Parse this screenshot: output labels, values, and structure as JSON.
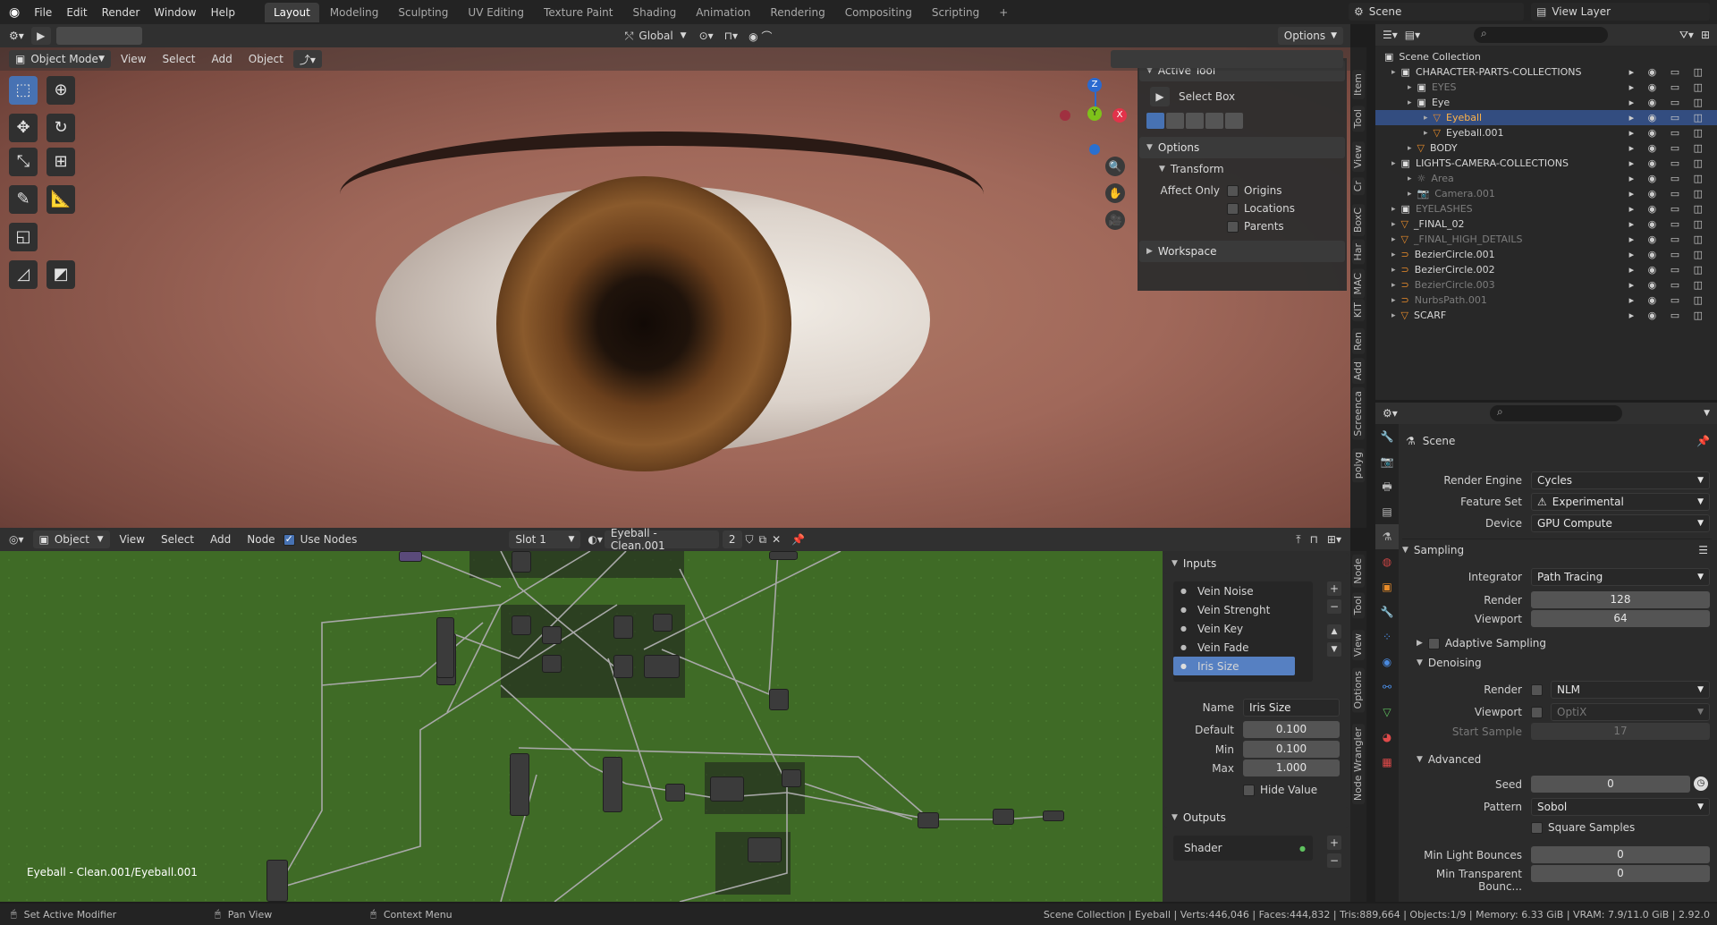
{
  "topbar": {
    "menus": [
      "File",
      "Edit",
      "Render",
      "Window",
      "Help"
    ],
    "workspaces": [
      "Layout",
      "Modeling",
      "Sculpting",
      "UV Editing",
      "Texture Paint",
      "Shading",
      "Animation",
      "Rendering",
      "Compositing",
      "Scripting"
    ],
    "active_workspace": "Layout",
    "add_tab": "+",
    "scene_name": "Scene",
    "view_layer": "View Layer"
  },
  "viewport": {
    "mode": "Object Mode",
    "menus": [
      "View",
      "Select",
      "Add",
      "Object"
    ],
    "transform_orientation": "Global",
    "options_label": "Options",
    "gizmo_axes": {
      "z": "Z",
      "y": "Y",
      "x": "X"
    }
  },
  "sidebar_n": {
    "active_tool_title": "Active Tool",
    "tool_name": "Select Box",
    "options_title": "Options",
    "transform_title": "Transform",
    "affect_only": "Affect Only",
    "checks": [
      "Origins",
      "Locations",
      "Parents"
    ],
    "workspace_title": "Workspace",
    "tabs": [
      "Item",
      "Tool",
      "View",
      "Cr",
      "BoxC",
      "Har",
      "MAC",
      "KIT",
      "Ren",
      "Add",
      "Screenca",
      "polyg"
    ]
  },
  "outliner": {
    "root": "Scene Collection",
    "rows": [
      {
        "label": "CHARACTER-PARTS-COLLECTIONS",
        "indent": 1,
        "kind": "coll",
        "dim": false,
        "sel": false
      },
      {
        "label": "EYES",
        "indent": 2,
        "kind": "coll",
        "dim": true,
        "sel": false
      },
      {
        "label": "Eye",
        "indent": 2,
        "kind": "coll",
        "dim": false,
        "sel": false
      },
      {
        "label": "Eyeball",
        "indent": 3,
        "kind": "obj",
        "dim": false,
        "sel": true
      },
      {
        "label": "Eyeball.001",
        "indent": 3,
        "kind": "obj",
        "dim": false,
        "sel": false
      },
      {
        "label": "BODY",
        "indent": 2,
        "kind": "obj",
        "dim": false,
        "sel": false
      },
      {
        "label": "LIGHTS-CAMERA-COLLECTIONS",
        "indent": 1,
        "kind": "coll",
        "dim": false,
        "sel": false
      },
      {
        "label": "Area",
        "indent": 2,
        "kind": "light",
        "dim": true,
        "sel": false
      },
      {
        "label": "Camera.001",
        "indent": 2,
        "kind": "cam",
        "dim": true,
        "sel": false
      },
      {
        "label": "EYELASHES",
        "indent": 1,
        "kind": "coll",
        "dim": true,
        "sel": false
      },
      {
        "label": "_FINAL_02",
        "indent": 1,
        "kind": "obj",
        "dim": false,
        "sel": false
      },
      {
        "label": "_FINAL_HIGH_DETAILS",
        "indent": 1,
        "kind": "obj",
        "dim": true,
        "sel": false
      },
      {
        "label": "BezierCircle.001",
        "indent": 1,
        "kind": "curve",
        "dim": false,
        "sel": false
      },
      {
        "label": "BezierCircle.002",
        "indent": 1,
        "kind": "curve",
        "dim": false,
        "sel": false
      },
      {
        "label": "BezierCircle.003",
        "indent": 1,
        "kind": "curve",
        "dim": true,
        "sel": false
      },
      {
        "label": "NurbsPath.001",
        "indent": 1,
        "kind": "curve",
        "dim": true,
        "sel": false
      },
      {
        "label": "SCARF",
        "indent": 1,
        "kind": "obj",
        "dim": false,
        "sel": false
      }
    ]
  },
  "properties": {
    "scene_label": "Scene",
    "render_engine_label": "Render Engine",
    "render_engine": "Cycles",
    "feature_set_label": "Feature Set",
    "feature_set": "Experimental",
    "device_label": "Device",
    "device": "GPU Compute",
    "sampling_title": "Sampling",
    "integrator_label": "Integrator",
    "integrator": "Path Tracing",
    "render_label": "Render",
    "render_samples": "128",
    "viewport_label": "Viewport",
    "viewport_samples": "64",
    "adaptive_sampling": "Adaptive Sampling",
    "denoising_title": "Denoising",
    "den_render_label": "Render",
    "den_render": "NLM",
    "den_viewport_label": "Viewport",
    "den_viewport": "OptiX",
    "start_sample_label": "Start Sample",
    "start_sample": "17",
    "advanced_title": "Advanced",
    "seed_label": "Seed",
    "seed": "0",
    "pattern_label": "Pattern",
    "pattern": "Sobol",
    "square_samples": "Square Samples",
    "min_light_label": "Min Light Bounces",
    "min_light": "0",
    "min_trans_label": "Min Transparent Bounc...",
    "min_trans": "0"
  },
  "node_editor": {
    "object_label": "Object",
    "menus": [
      "View",
      "Select",
      "Add",
      "Node"
    ],
    "use_nodes": "Use Nodes",
    "slot": "Slot 1",
    "material": "Eyeball - Clean.001",
    "users": "2",
    "breadcrumb": "Eyeball - Clean.001/Eyeball.001",
    "tabs": [
      "Node",
      "Tool",
      "View",
      "Options",
      "Node Wrangler"
    ]
  },
  "group_panel": {
    "inputs_title": "Inputs",
    "inputs": [
      "Vein Noise",
      "Vein Strenght",
      "Vein Key",
      "Vein Fade",
      "Iris Size"
    ],
    "selected_input": "Iris Size",
    "name_label": "Name",
    "name_value": "Iris Size",
    "default_label": "Default",
    "default_value": "0.100",
    "min_label": "Min",
    "min_value": "0.100",
    "max_label": "Max",
    "max_value": "1.000",
    "hide_value": "Hide Value",
    "outputs_title": "Outputs",
    "outputs": [
      "Shader"
    ]
  },
  "statusbar": {
    "hint1": "Set Active Modifier",
    "hint2": "Pan View",
    "hint3": "Context Menu",
    "stats": "Scene Collection | Eyeball | Verts:446,046 | Faces:444,832 | Tris:889,664 | Objects:1/9 | Memory: 6.33 GiB | VRAM: 7.9/11.0 GiB | 2.92.0"
  },
  "colors": {
    "accent": "#4772b3",
    "selection": "#334d80",
    "node_bg": "#3f6b26",
    "header": "#303030"
  }
}
